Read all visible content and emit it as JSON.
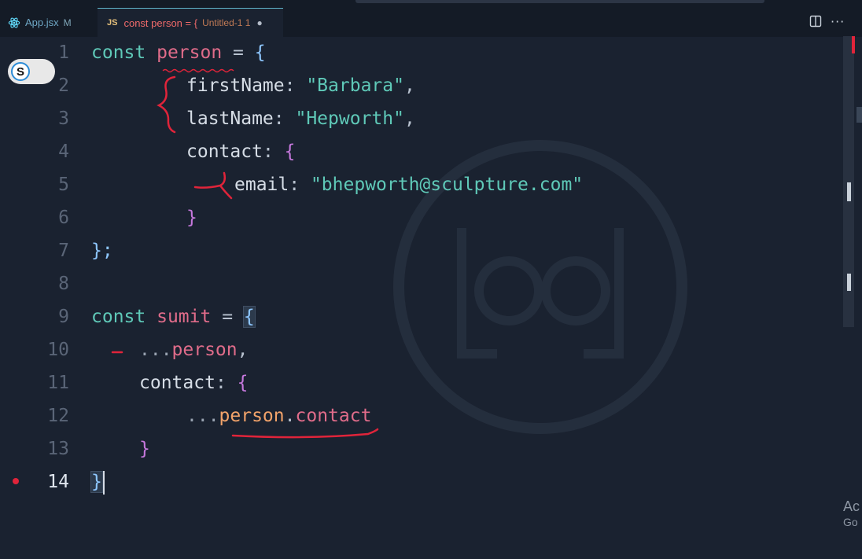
{
  "tabs": [
    {
      "icon": "react-icon",
      "label": "App.jsx",
      "status": "M"
    },
    {
      "icon": "js-badge",
      "badge": "JS",
      "label": "const person = {",
      "detail": "Untitled-1 1",
      "dirty": "●"
    }
  ],
  "toggle": {
    "letter": "S"
  },
  "editor": {
    "line_numbers": [
      "1",
      "2",
      "3",
      "4",
      "5",
      "6",
      "7",
      "8",
      "9",
      "10",
      "11",
      "12",
      "13",
      "14"
    ],
    "current_line": "14",
    "tokens": {
      "const": "const",
      "person": "person",
      "eq_brace": " = ",
      "open": "{",
      "firstName": "firstName",
      "colon": ": ",
      "barbara": "\"Barbara\"",
      "comma": ",",
      "lastName": "lastName",
      "hepworth": "\"Hepworth\"",
      "contact": "contact",
      "email": "email",
      "email_value": "\"bhepworth@sculpture.com\"",
      "close": "}",
      "close_semi": "};",
      "sumit": "sumit",
      "spread": "...",
      "dot": ".",
      "person_comma": ","
    }
  },
  "side_text": {
    "line1": "Ac",
    "line2": "Go"
  },
  "colors": {
    "background": "#1a2230",
    "keyword": "#5fc9b8",
    "variable": "#e06c8a",
    "string": "#5fc9b8",
    "brace": "#c678dd",
    "annotation": "#e0243a"
  }
}
